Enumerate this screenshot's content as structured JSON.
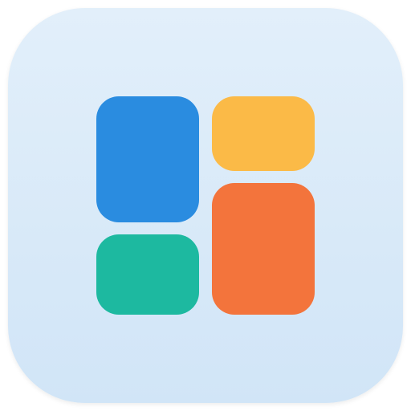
{
  "icon": {
    "background_top": "#e2effa",
    "background_bottom": "#d1e5f7",
    "tiles": [
      {
        "name": "tile-blue",
        "color": "#2a8ce0"
      },
      {
        "name": "tile-yellow",
        "color": "#fbba47"
      },
      {
        "name": "tile-orange",
        "color": "#f3743c"
      },
      {
        "name": "tile-green",
        "color": "#1db9a0"
      }
    ]
  }
}
